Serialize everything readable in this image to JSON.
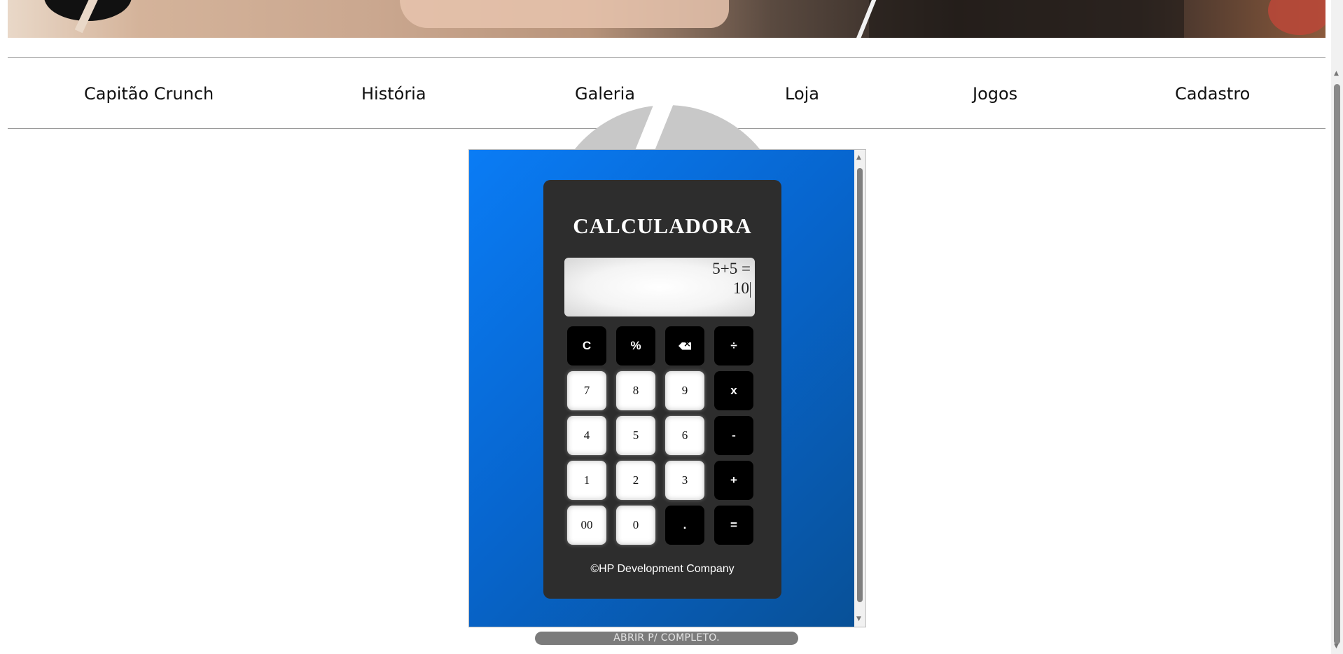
{
  "nav": {
    "items": [
      {
        "label": "Capitão Crunch"
      },
      {
        "label": "História"
      },
      {
        "label": "Galeria"
      },
      {
        "label": "Loja"
      },
      {
        "label": "Jogos"
      },
      {
        "label": "Cadastro"
      }
    ]
  },
  "calculator": {
    "title": "CALCULADORA",
    "display": {
      "expression": "5+5 =",
      "result": "10"
    },
    "keys": [
      {
        "label": "C",
        "style": "dark"
      },
      {
        "label": "%",
        "style": "dark"
      },
      {
        "label": "",
        "icon": "backspace-icon",
        "style": "dark"
      },
      {
        "label": "÷",
        "style": "dark"
      },
      {
        "label": "7",
        "style": "light"
      },
      {
        "label": "8",
        "style": "light"
      },
      {
        "label": "9",
        "style": "light"
      },
      {
        "label": "x",
        "style": "dark"
      },
      {
        "label": "4",
        "style": "light"
      },
      {
        "label": "5",
        "style": "light"
      },
      {
        "label": "6",
        "style": "light"
      },
      {
        "label": "-",
        "style": "dark"
      },
      {
        "label": "1",
        "style": "light"
      },
      {
        "label": "2",
        "style": "light"
      },
      {
        "label": "3",
        "style": "light"
      },
      {
        "label": "+",
        "style": "dark"
      },
      {
        "label": "00",
        "style": "light"
      },
      {
        "label": "0",
        "style": "light"
      },
      {
        "label": ".",
        "style": "dark"
      },
      {
        "label": "=",
        "style": "dark"
      }
    ],
    "footer": "©HP Development Company"
  },
  "open_full_button": "ABRIR P/ COMPLETO.",
  "colors": {
    "embed_gradient_start": "#0a7cf5",
    "embed_gradient_end": "#085096",
    "calculator_body": "#2d2d2d",
    "open_button_bg": "#7b7b7b"
  }
}
